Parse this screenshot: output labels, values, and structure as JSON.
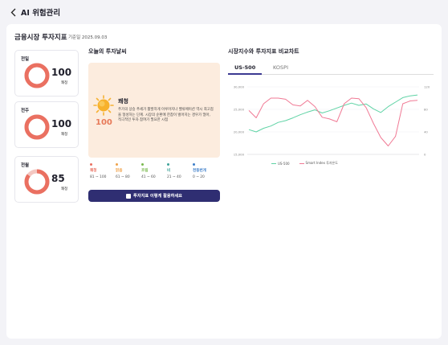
{
  "app": {
    "title": "AI 위험관리",
    "back_icon": "chevron-left-icon"
  },
  "page": {
    "title": "금융시장 투자지표",
    "base_date": "기준일 2025.09.03"
  },
  "gauges": [
    {
      "label": "전일",
      "value": "100",
      "state": "쾌청",
      "level": 1.0,
      "color": "#ea7061"
    },
    {
      "label": "전주",
      "value": "100",
      "state": "쾌청",
      "level": 1.0,
      "color": "#ea7061"
    },
    {
      "label": "전월",
      "value": "85",
      "state": "쾌청",
      "level": 0.85,
      "color": "#ea7061"
    }
  ],
  "weather": {
    "section_title": "오늘의 투자날씨",
    "icon": "sun-icon",
    "name": "쾌청",
    "score": "100",
    "description": "주가의 상승 추세가 활발하게 이루어지나 밸류에이션 역시 최고점을 형성하는 단계. 시장의 순환에 한참이 벌어지는 경우가 많아, 적극적인 투자 참여가 필요한 시점",
    "legend": [
      {
        "name": "쾌청",
        "range": "81 ~ 100",
        "color": "#ea7061"
      },
      {
        "name": "맑음",
        "range": "61 ~ 80",
        "color": "#f0a24a"
      },
      {
        "name": "흐림",
        "range": "41 ~ 60",
        "color": "#79b84d"
      },
      {
        "name": "비",
        "range": "21 ~ 40",
        "color": "#3fa39a"
      },
      {
        "name": "천둥번개",
        "range": "0 ~ 20",
        "color": "#3d7ec9"
      }
    ],
    "cta_label": "투자지표 이렇게 활용하세요"
  },
  "compare": {
    "section_title": "시장지수와 투자지표 비교차트",
    "tabs": [
      "US-500",
      "KOSPI"
    ],
    "active_tab": 0
  },
  "chart_data": {
    "type": "line",
    "y_left": {
      "ticks": [
        "30,000",
        "25,000",
        "20,000",
        "15,000"
      ],
      "range": [
        15000,
        30000
      ]
    },
    "y_right": {
      "ticks": [
        "120",
        "80",
        "40",
        "0"
      ],
      "range": [
        0,
        120
      ]
    },
    "series": [
      {
        "name": "US-500",
        "axis": "left",
        "color": "#5fd3a5",
        "values": [
          20500,
          20000,
          20800,
          21300,
          22100,
          22500,
          23100,
          23800,
          24400,
          24900,
          24200,
          24700,
          25300,
          25900,
          26400,
          25900,
          26200,
          25100,
          24300,
          25600,
          26600,
          27600,
          28000,
          28200
        ]
      },
      {
        "name": "Smart Index 투자온도",
        "axis": "right",
        "color": "#f07a95",
        "values": [
          78,
          65,
          90,
          100,
          100,
          98,
          88,
          86,
          96,
          85,
          66,
          63,
          58,
          90,
          100,
          99,
          83,
          55,
          30,
          15,
          32,
          90,
          95,
          96
        ]
      }
    ]
  }
}
